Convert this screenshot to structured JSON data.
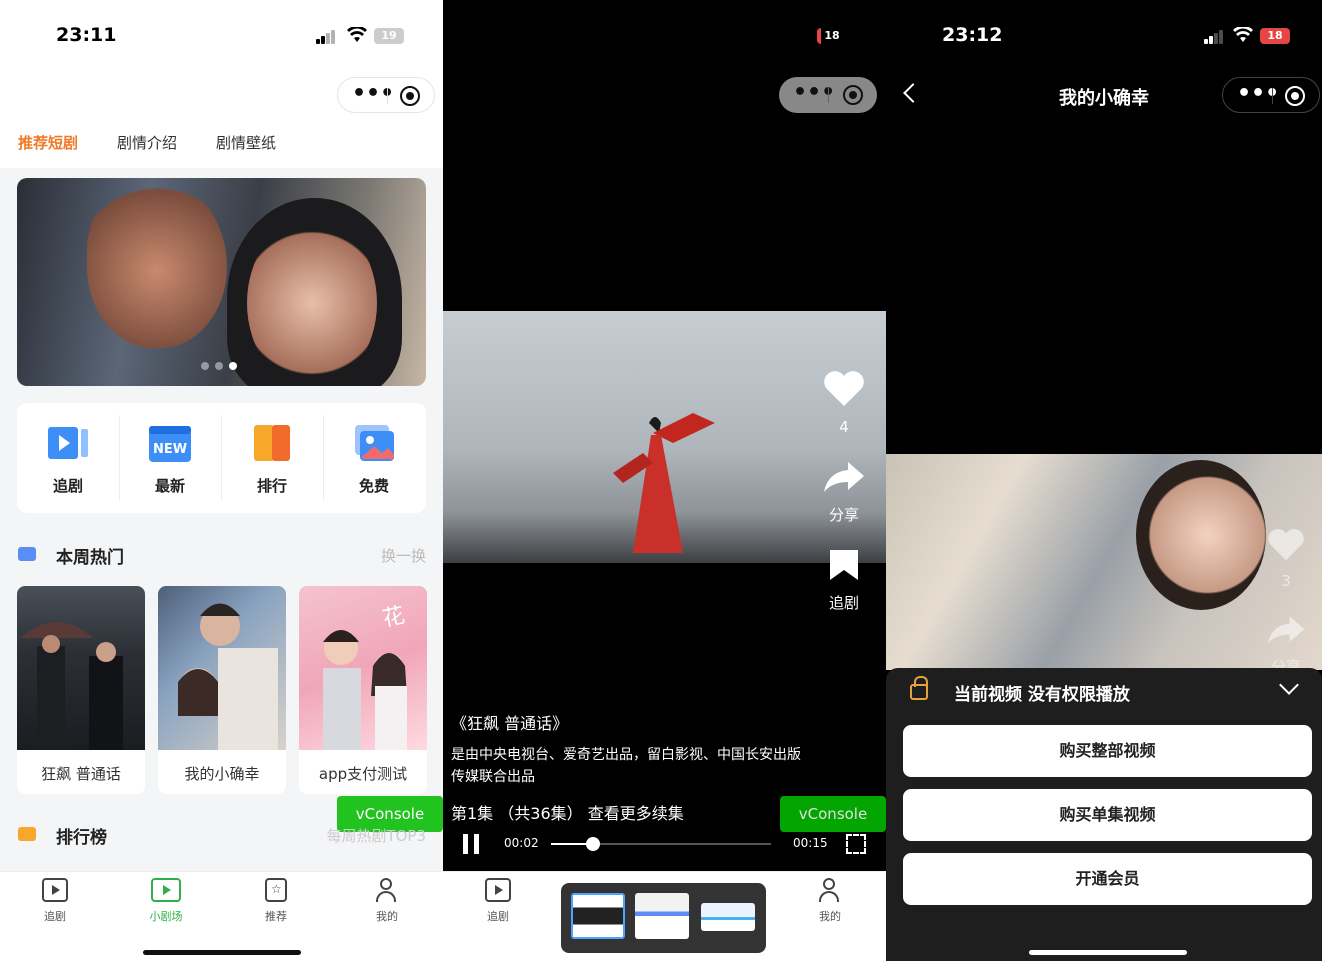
{
  "panel1": {
    "status": {
      "time": "23:11",
      "battery": "19"
    },
    "tabs": [
      "推荐短剧",
      "剧情介绍",
      "剧情壁纸"
    ],
    "quick": [
      "追剧",
      "最新",
      "排行",
      "免费"
    ],
    "new_badge": "NEW",
    "hot": {
      "title": "本周热门",
      "more": "换一换"
    },
    "cards": [
      "狂飙 普通话",
      "我的小确幸",
      "app支付测试"
    ],
    "rank": {
      "title": "排行榜",
      "more": "每周热剧TOP3"
    },
    "vconsole": "vConsole",
    "tabbar": [
      "追剧",
      "小剧场",
      "推荐",
      "我的"
    ]
  },
  "panel2": {
    "battery": "18",
    "likes": "4",
    "share": "分享",
    "follow": "追剧",
    "title": "《狂飙 普通话》",
    "desc": "是由中央电视台、爱奇艺出品，留白影视、中国长安出版传媒联合出品",
    "episode": "第1集 （共36集） 查看更多续集",
    "current_time": "00:02",
    "duration": "00:15",
    "progress": 0.19,
    "vconsole": "vConsole",
    "tabbar": [
      "追剧",
      "我的"
    ]
  },
  "panel3": {
    "status": {
      "time": "23:12",
      "battery": "18"
    },
    "nav_title": "我的小确幸",
    "likes": "3",
    "share": "分享",
    "sheet_title": "当前视频 没有权限播放",
    "buttons": [
      "购买整部视频",
      "购买单集视频",
      "开通会员"
    ]
  },
  "colors": {
    "accent": "#f07a28",
    "green": "#2fb04a",
    "vconsole": "#04be02",
    "lock": "#e7a23c"
  }
}
